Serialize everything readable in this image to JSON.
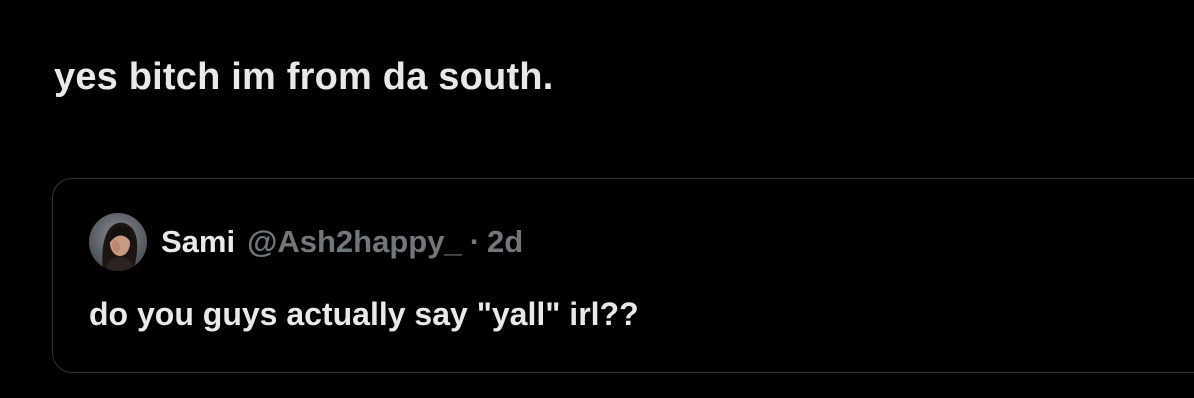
{
  "post": {
    "text": "yes bitch im from da south."
  },
  "quoted_post": {
    "avatar_icon": "avatar",
    "author_name": "Sami",
    "author_handle": "@Ash2happy_",
    "separator": "·",
    "timestamp": "2d",
    "text": "do you guys actually say \"yall\" irl??"
  },
  "colors": {
    "background": "#000000",
    "primary_text": "#e7e9ea",
    "secondary_text": "#71767b",
    "border": "#2f3336"
  }
}
